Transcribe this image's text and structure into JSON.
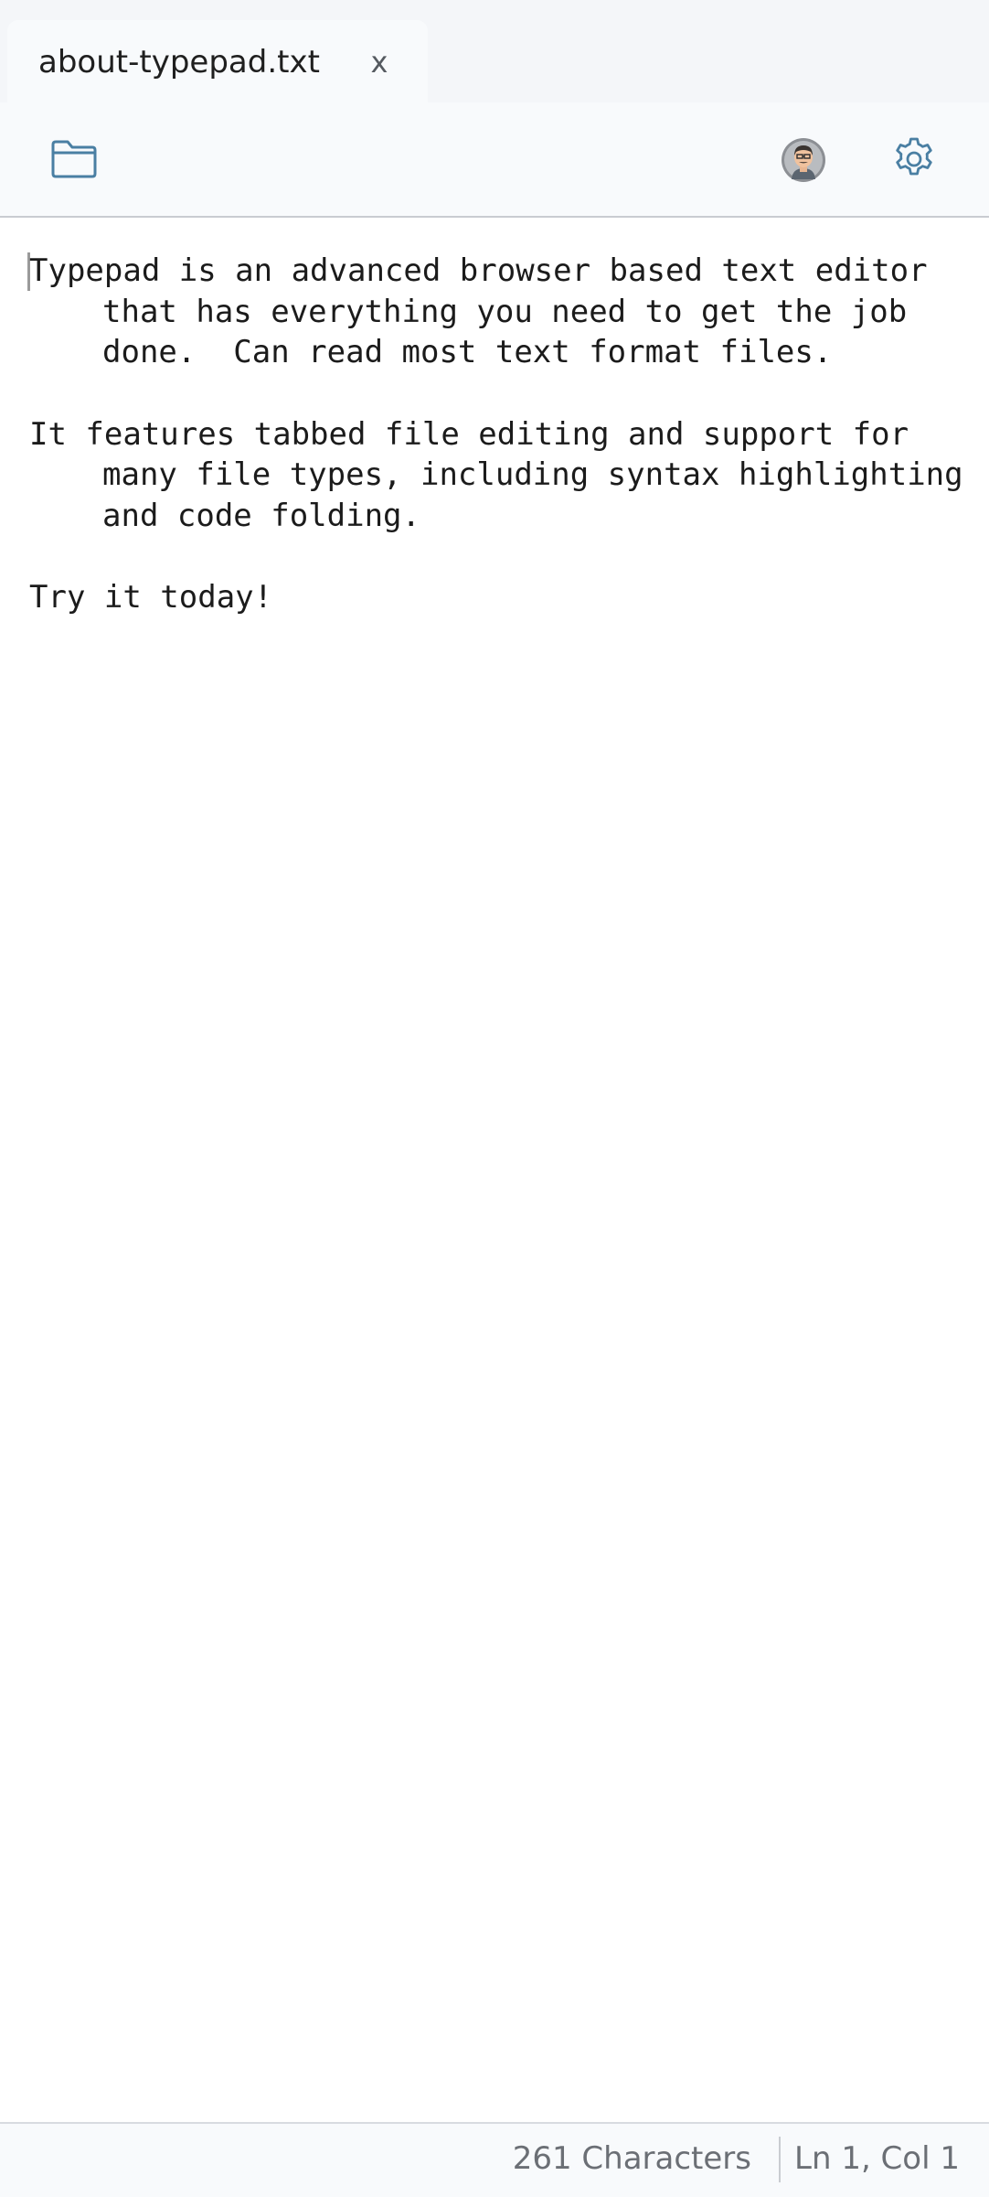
{
  "tabs": [
    {
      "label": "about-typepad.txt",
      "close_label": "x"
    }
  ],
  "toolbar": {
    "folder_icon": "folder-icon",
    "avatar_icon": "avatar-icon",
    "settings_icon": "gear-icon"
  },
  "editor": {
    "lines": [
      "Typepad is an advanced browser based text editor",
      "that has everything you need to get the job",
      "done.  Can read most text format files.",
      "",
      "It features tabbed file editing and support for",
      "many file types, including syntax highlighting",
      "and code folding.",
      "",
      "Try it today!"
    ]
  },
  "status": {
    "characters": "261 Characters",
    "position": "Ln 1, Col 1"
  },
  "colors": {
    "icon_stroke": "#4a7fa3",
    "background": "#ffffff",
    "chrome": "#f8fafc"
  }
}
